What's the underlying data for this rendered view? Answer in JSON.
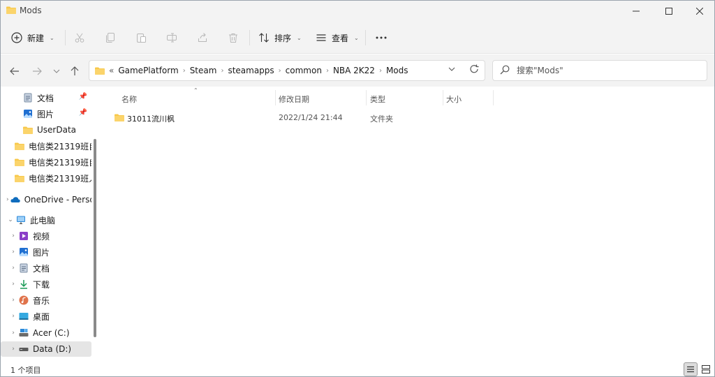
{
  "window": {
    "title": "Mods"
  },
  "toolbar": {
    "new_label": "新建",
    "sort_label": "排序",
    "view_label": "查看"
  },
  "address": {
    "overflow": "«",
    "crumbs": [
      "GamePlatform",
      "Steam",
      "steamapps",
      "common",
      "NBA 2K22",
      "Mods"
    ]
  },
  "search": {
    "placeholder": "搜索\"Mods\""
  },
  "sidebar": {
    "quick": [
      {
        "label": "文档",
        "icon": "document-icon",
        "pinned": true
      },
      {
        "label": "图片",
        "icon": "pictures-icon",
        "pinned": true
      },
      {
        "label": "UserData",
        "icon": "folder-icon"
      },
      {
        "label": "电信类21319班自",
        "icon": "folder-icon"
      },
      {
        "label": "电信类21319班自",
        "icon": "folder-icon"
      },
      {
        "label": "电信类21319班人",
        "icon": "folder-icon"
      }
    ],
    "onedrive": {
      "label": "OneDrive - Perso"
    },
    "thispc": {
      "label": "此电脑",
      "items": [
        {
          "label": "视频",
          "icon": "videos-icon"
        },
        {
          "label": "图片",
          "icon": "pictures-icon"
        },
        {
          "label": "文档",
          "icon": "document-icon"
        },
        {
          "label": "下载",
          "icon": "download-icon"
        },
        {
          "label": "音乐",
          "icon": "music-icon"
        },
        {
          "label": "桌面",
          "icon": "desktop-icon"
        },
        {
          "label": "Acer (C:)",
          "icon": "drive-c-icon"
        },
        {
          "label": "Data (D:)",
          "icon": "drive-d-icon"
        }
      ]
    }
  },
  "columns": {
    "name": "名称",
    "modified": "修改日期",
    "type": "类型",
    "size": "大小"
  },
  "files": [
    {
      "name": "31011流川枫",
      "modified": "2022/1/24 21:44",
      "type": "文件夹",
      "size": ""
    }
  ],
  "status": {
    "count": "1 个项目"
  },
  "colors": {
    "folder": "#f8c84a",
    "accent": "#0067c0"
  }
}
